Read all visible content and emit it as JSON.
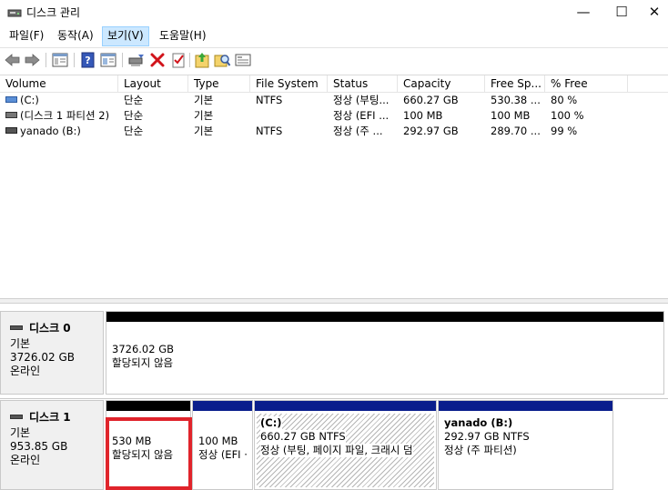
{
  "window": {
    "title": "디스크 관리",
    "minimize_glyph": "—",
    "maximize_glyph": "☐",
    "close_glyph": "✕"
  },
  "menu": [
    {
      "label": "파일(F)"
    },
    {
      "label": "동작(A)"
    },
    {
      "label": "보기(V)"
    },
    {
      "label": "도움말(H)"
    }
  ],
  "toolbar": {
    "buttons": [
      "back-icon",
      "forward-icon",
      "console-tree-icon",
      "help-icon",
      "properties-icon",
      "connect-drive-icon",
      "delete-icon",
      "checklist-icon",
      "export-icon",
      "find-icon",
      "view-icon"
    ]
  },
  "volume_list": {
    "columns": [
      "Volume",
      "Layout",
      "Type",
      "File System",
      "Status",
      "Capacity",
      "Free Sp...",
      "% Free"
    ],
    "rows": [
      {
        "volume": "(C:)",
        "layout": "단순",
        "type": "기본",
        "fs": "NTFS",
        "status": "정상 (부팅...",
        "capacity": "660.27 GB",
        "free": "530.38 ...",
        "pct": "80 %"
      },
      {
        "volume": "(디스크 1 파티션 2)",
        "layout": "단순",
        "type": "기본",
        "fs": "",
        "status": "정상 (EFI ...",
        "capacity": "100 MB",
        "free": "100 MB",
        "pct": "100 %"
      },
      {
        "volume": "yanado (B:)",
        "layout": "단순",
        "type": "기본",
        "fs": "NTFS",
        "status": "정상 (주 ...",
        "capacity": "292.97 GB",
        "free": "289.70 ...",
        "pct": "99 %"
      }
    ]
  },
  "disks": [
    {
      "name": "디스크 0",
      "type": "기본",
      "size": "3726.02 GB",
      "state": "온라인",
      "partitions": [
        {
          "line1": "3726.02 GB",
          "line2": "할당되지 않음",
          "line3": ""
        }
      ]
    },
    {
      "name": "디스크 1",
      "type": "기본",
      "size": "953.85 GB",
      "state": "온라인",
      "partitions": [
        {
          "line1": "530 MB",
          "line2": "할당되지 않음",
          "line3": ""
        },
        {
          "line1": "100 MB",
          "line2": "정상 (EFI ·",
          "line3": ""
        },
        {
          "line1": "(C:)",
          "line2": "660.27 GB NTFS",
          "line3": "정상 (부팅, 페이지 파일, 크래시 덤"
        },
        {
          "line1": "yanado  (B:)",
          "line2": "292.97 GB NTFS",
          "line3": "정상 (주 파티션)"
        }
      ]
    }
  ],
  "colors": {
    "unallocated_bar": "#000000",
    "primary_bar": "#0a1e8c",
    "highlight": "#e0242b",
    "menu_active": "#cce8ff"
  }
}
